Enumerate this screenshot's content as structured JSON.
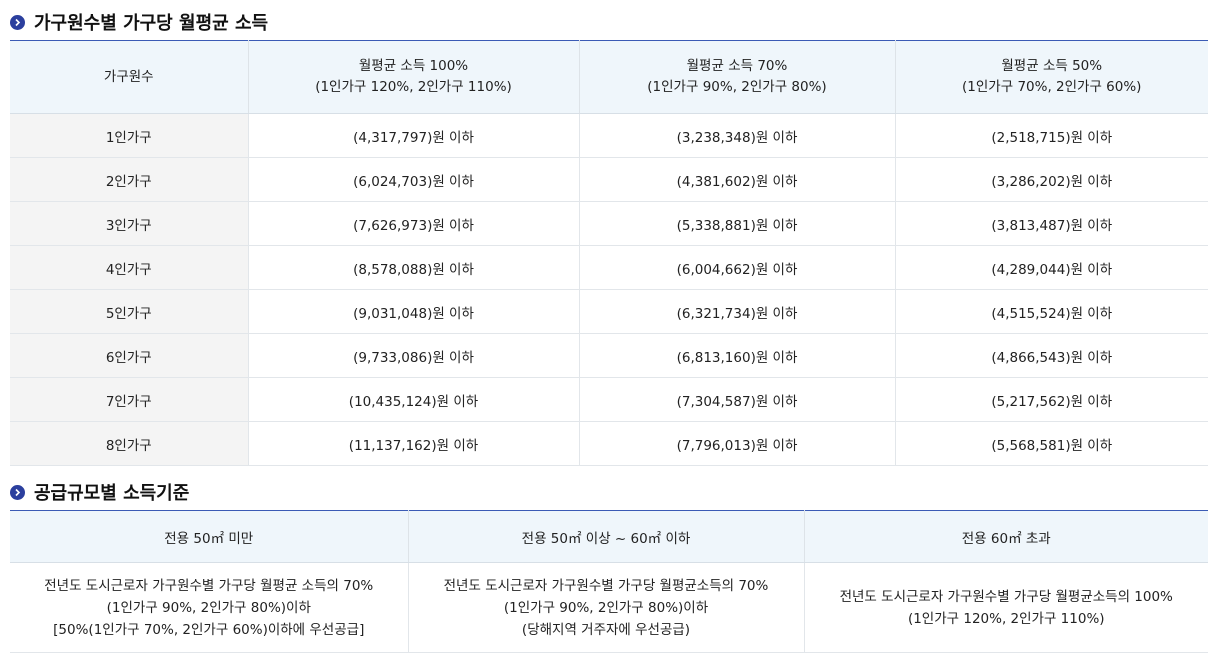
{
  "section1": {
    "title": "가구원수별 가구당 월평균 소득",
    "header": {
      "col0": "가구원수",
      "col1_line1": "월평균 소득 100%",
      "col1_line2": "(1인가구 120%, 2인가구 110%)",
      "col2_line1": "월평균 소득 70%",
      "col2_line2": "(1인가구 90%, 2인가구 80%)",
      "col3_line1": "월평균 소득 50%",
      "col3_line2": "(1인가구 70%, 2인가구 60%)"
    },
    "rows": [
      {
        "label": "1인가구",
        "c1": "(4,317,797)원 이하",
        "c2": "(3,238,348)원 이하",
        "c3": "(2,518,715)원 이하"
      },
      {
        "label": "2인가구",
        "c1": "(6,024,703)원 이하",
        "c2": "(4,381,602)원 이하",
        "c3": "(3,286,202)원 이하"
      },
      {
        "label": "3인가구",
        "c1": "(7,626,973)원 이하",
        "c2": "(5,338,881)원 이하",
        "c3": "(3,813,487)원 이하"
      },
      {
        "label": "4인가구",
        "c1": "(8,578,088)원 이하",
        "c2": "(6,004,662)원 이하",
        "c3": "(4,289,044)원 이하"
      },
      {
        "label": "5인가구",
        "c1": "(9,031,048)원 이하",
        "c2": "(6,321,734)원 이하",
        "c3": "(4,515,524)원 이하"
      },
      {
        "label": "6인가구",
        "c1": "(9,733,086)원 이하",
        "c2": "(6,813,160)원 이하",
        "c3": "(4,866,543)원 이하"
      },
      {
        "label": "7인가구",
        "c1": "(10,435,124)원 이하",
        "c2": "(7,304,587)원 이하",
        "c3": "(5,217,562)원 이하"
      },
      {
        "label": "8인가구",
        "c1": "(11,137,162)원 이하",
        "c2": "(7,796,013)원 이하",
        "c3": "(5,568,581)원 이하"
      }
    ]
  },
  "section2": {
    "title": "공급규모별 소득기준",
    "header": {
      "col1": "전용 50㎡ 미만",
      "col2": "전용 50㎡ 이상 ~ 60㎡ 이하",
      "col3": "전용 60㎡ 초과"
    },
    "body": {
      "col1": [
        "전년도 도시근로자 가구원수별 가구당 월평균 소득의 70%",
        "(1인가구 90%, 2인가구 80%)이하",
        "[50%(1인가구 70%, 2인가구 60%)이하에 우선공급]"
      ],
      "col2": [
        "전년도 도시근로자 가구원수별 가구당 월평균소득의 70%",
        "(1인가구 90%, 2인가구 80%)이하",
        "(당해지역 거주자에 우선공급)"
      ],
      "col3": [
        "전년도 도시근로자 가구원수별 가구당 월평균소득의 100%",
        "(1인가구 120%, 2인가구 110%)"
      ]
    }
  },
  "icons": {
    "bullet": "chevron-right-circle-icon"
  },
  "colors": {
    "accent": "#2b3f9e",
    "header_bg": "#eff6fb",
    "rowhead_bg": "#f4f4f4"
  }
}
